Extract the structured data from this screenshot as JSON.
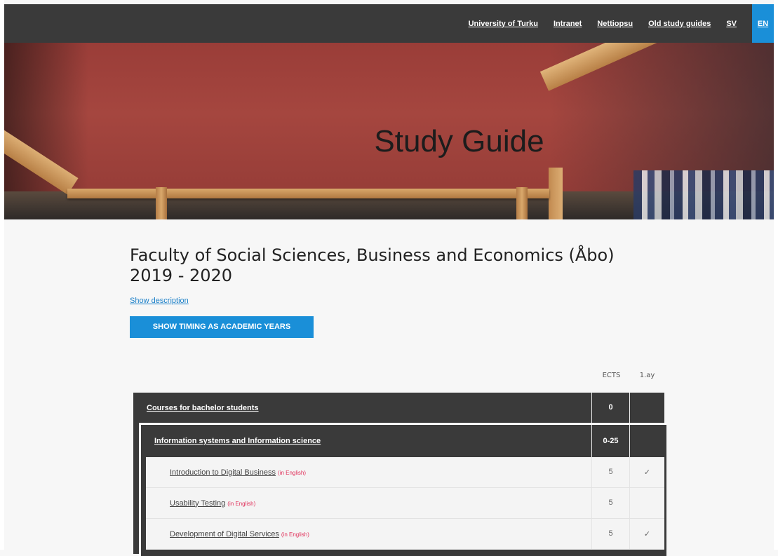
{
  "nav": {
    "links": [
      "University of Turku",
      "Intranet",
      "Nettiopsu",
      "Old study guides",
      "SV"
    ],
    "active_lang": "EN"
  },
  "hero": {
    "title": "Study Guide"
  },
  "main": {
    "faculty_title_line1": "Faculty of Social Sciences, Business and Economics (Åbo)",
    "faculty_title_line2": "2019 - 2020",
    "show_description": "Show description",
    "timing_button": "SHOW TIMING AS ACADEMIC YEARS"
  },
  "table": {
    "col_ects": "ECTS",
    "col_ay": "1.ay",
    "group": {
      "name": "Courses for bachelor students",
      "ects": "0",
      "ay": ""
    },
    "subgroup": {
      "name": "Information systems and Information science",
      "ects": "0-25",
      "ay": ""
    },
    "courses": [
      {
        "name": "Introduction to Digital Business",
        "lang": "(in English)",
        "ects": "5",
        "ay": "✓"
      },
      {
        "name": "Usability Testing",
        "lang": "(in English)",
        "ects": "5",
        "ay": ""
      },
      {
        "name": "Development of Digital Services",
        "lang": "(in English)",
        "ects": "5",
        "ay": "✓"
      }
    ]
  }
}
